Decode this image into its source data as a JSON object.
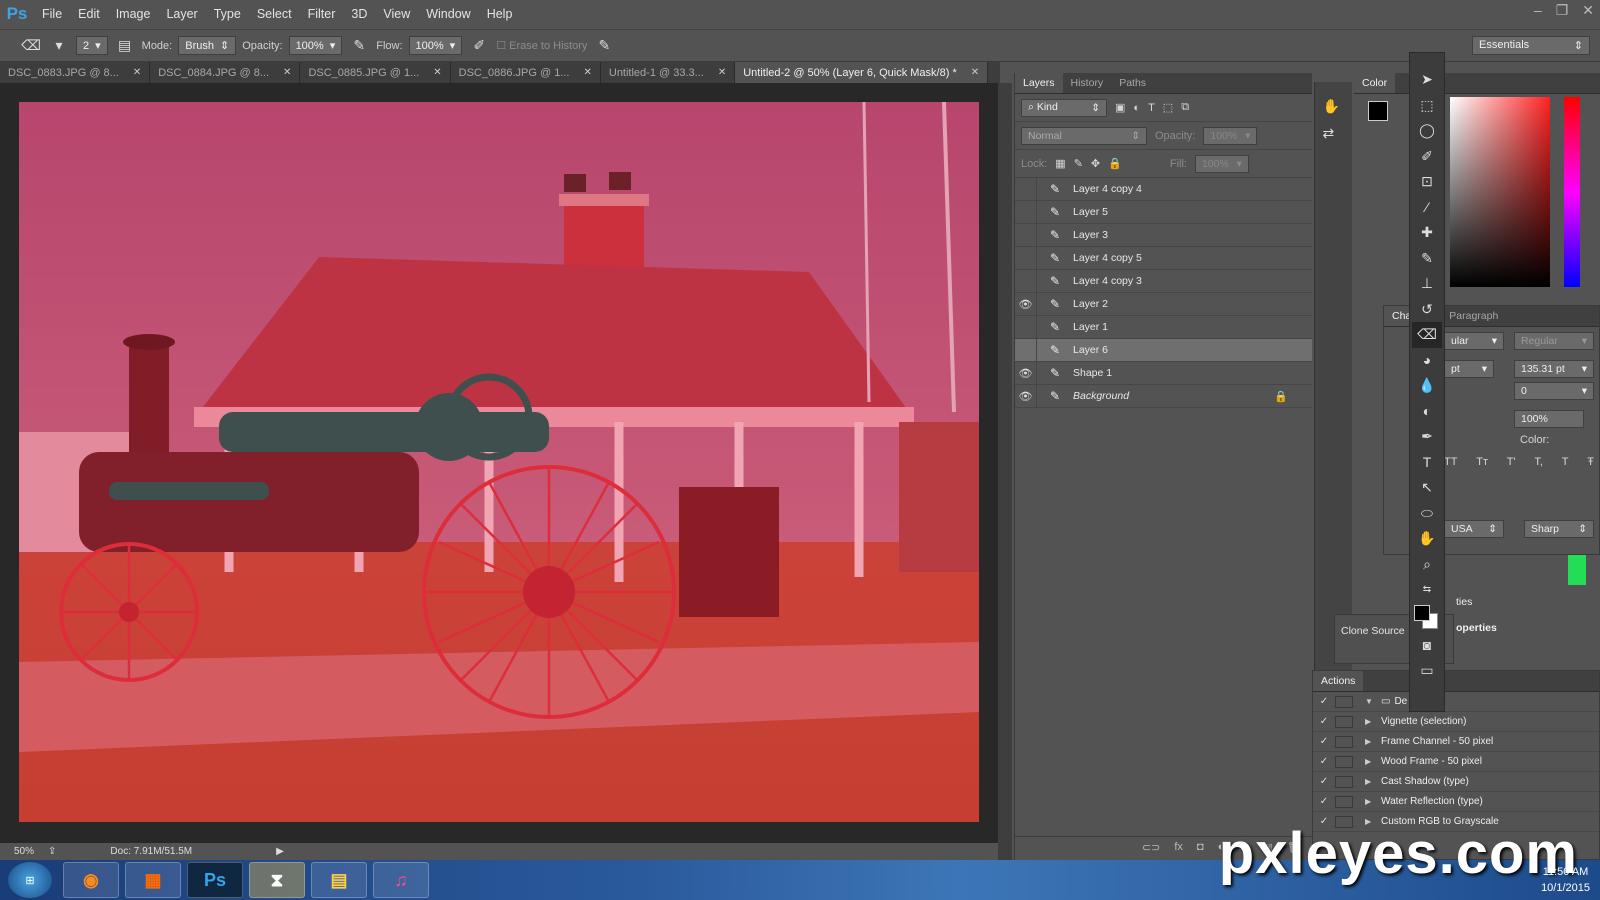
{
  "app": {
    "logo": "Ps"
  },
  "menu": [
    "File",
    "Edit",
    "Image",
    "Layer",
    "Type",
    "Select",
    "Filter",
    "3D",
    "View",
    "Window",
    "Help"
  ],
  "window_controls": [
    "–",
    "❐",
    "✕"
  ],
  "options_bar": {
    "brush_size": "2",
    "mode_label": "Mode:",
    "mode_value": "Brush",
    "opacity_label": "Opacity:",
    "opacity_value": "100%",
    "flow_label": "Flow:",
    "flow_value": "100%",
    "erase_history": "Erase to History",
    "workspace": "Essentials"
  },
  "doc_tabs": [
    {
      "label": "DSC_0883.JPG @ 8...",
      "active": false
    },
    {
      "label": "DSC_0884.JPG @ 8...",
      "active": false
    },
    {
      "label": "DSC_0885.JPG @ 1...",
      "active": false
    },
    {
      "label": "DSC_0886.JPG @ 1...",
      "active": false
    },
    {
      "label": "Untitled-1 @ 33.3...",
      "active": false
    },
    {
      "label": "Untitled-2 @ 50% (Layer 6, Quick Mask/8) *",
      "active": true
    }
  ],
  "status": {
    "zoom": "50%",
    "doc": "Doc: 7.91M/51.5M"
  },
  "layers_panel": {
    "tabs": [
      "Layers",
      "History",
      "Paths"
    ],
    "filter": "Kind",
    "blend": "Normal",
    "opacity_label": "Opacity:",
    "opacity_value": "100%",
    "lock_label": "Lock:",
    "fill_label": "Fill:",
    "fill_value": "100%",
    "layers": [
      {
        "name": "Layer 4 copy 4",
        "visible": false,
        "selected": false
      },
      {
        "name": "Layer 5",
        "visible": false,
        "selected": false
      },
      {
        "name": "Layer 3",
        "visible": false,
        "selected": false
      },
      {
        "name": "Layer 4 copy 5",
        "visible": false,
        "selected": false
      },
      {
        "name": "Layer 4 copy 3",
        "visible": false,
        "selected": false
      },
      {
        "name": "Layer 2",
        "visible": true,
        "selected": false
      },
      {
        "name": "Layer 1",
        "visible": false,
        "selected": false
      },
      {
        "name": "Layer 6",
        "visible": false,
        "selected": true
      },
      {
        "name": "Shape 1",
        "visible": true,
        "selected": false
      },
      {
        "name": "Background",
        "visible": true,
        "selected": false,
        "locked": true
      }
    ],
    "footer_icons": [
      "⊂⊃",
      "fx",
      "◘",
      "◐",
      "▭",
      "▣",
      "🗑"
    ]
  },
  "color_panel": {
    "tab": "Color"
  },
  "char_panel": {
    "tabs": [
      "Cha",
      "Paragraph"
    ],
    "font_style": "ular",
    "style2": "Regular",
    "size": "pt",
    "leading": "135.31 pt",
    "tracking": "0",
    "scale": "100%",
    "color_label": "Color:",
    "lang": "USA",
    "aa": "Sharp",
    "typestyles": [
      "TT",
      "Tт",
      "T'",
      "T,",
      "T",
      "Ŧ"
    ]
  },
  "clone_source": {
    "label": "Clone Source"
  },
  "properties": {
    "tab": "ties",
    "title": "operties"
  },
  "actions_panel": {
    "tab": "Actions",
    "items": [
      {
        "name": "De      ions",
        "folder": true
      },
      {
        "name": "Vignette (selection)"
      },
      {
        "name": "Frame Channel - 50 pixel"
      },
      {
        "name": "Wood Frame - 50 pixel"
      },
      {
        "name": "Cast Shadow (type)"
      },
      {
        "name": "Water Reflection (type)"
      },
      {
        "name": "Custom RGB to Grayscale"
      }
    ]
  },
  "taskbar": {
    "apps": [
      "firefox",
      "office",
      "Ps",
      "blender",
      "folder",
      "itunes"
    ],
    "time": "11:50 AM",
    "date": "10/1/2015"
  },
  "watermark": "pxleyes.com",
  "colors": {
    "panel": "#535353",
    "dark": "#282828",
    "quickmask": "#d8243b",
    "accent": "#3fa3e8"
  }
}
